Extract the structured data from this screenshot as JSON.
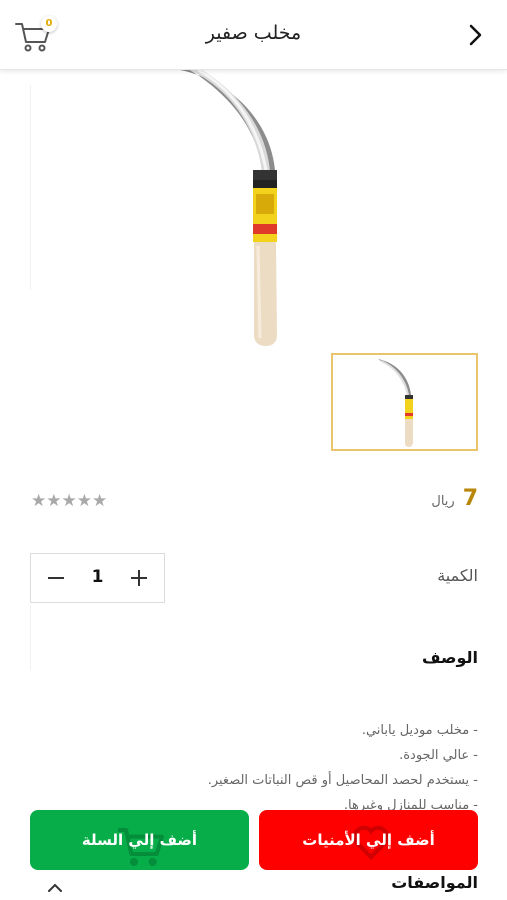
{
  "header": {
    "title": "مخلب صفير",
    "cart_count": "0"
  },
  "product": {
    "price_value": "7",
    "currency": "ريال",
    "rating": "★★★★★",
    "rating_value": 0
  },
  "quantity": {
    "label": "الكمية",
    "value": "1"
  },
  "description": {
    "title": "الوصف",
    "lines": [
      "- مخلب موديل ياباني.",
      "- عالي الجودة.",
      "- يستخدم لحصد المحاصيل أو قص النباتات الصغير.",
      "- مناسب للمنازل وغيرها."
    ]
  },
  "actions": {
    "add_to_wishlist": "أضف إلي الأمنيات",
    "add_to_cart": "أضف إلي السلة"
  },
  "specs": {
    "title": "المواصفات"
  },
  "colors": {
    "price": "#b8860b",
    "wishlist_button": "#ff0000",
    "cart_button": "#06ad48",
    "thumb_border": "#e9c46a"
  }
}
